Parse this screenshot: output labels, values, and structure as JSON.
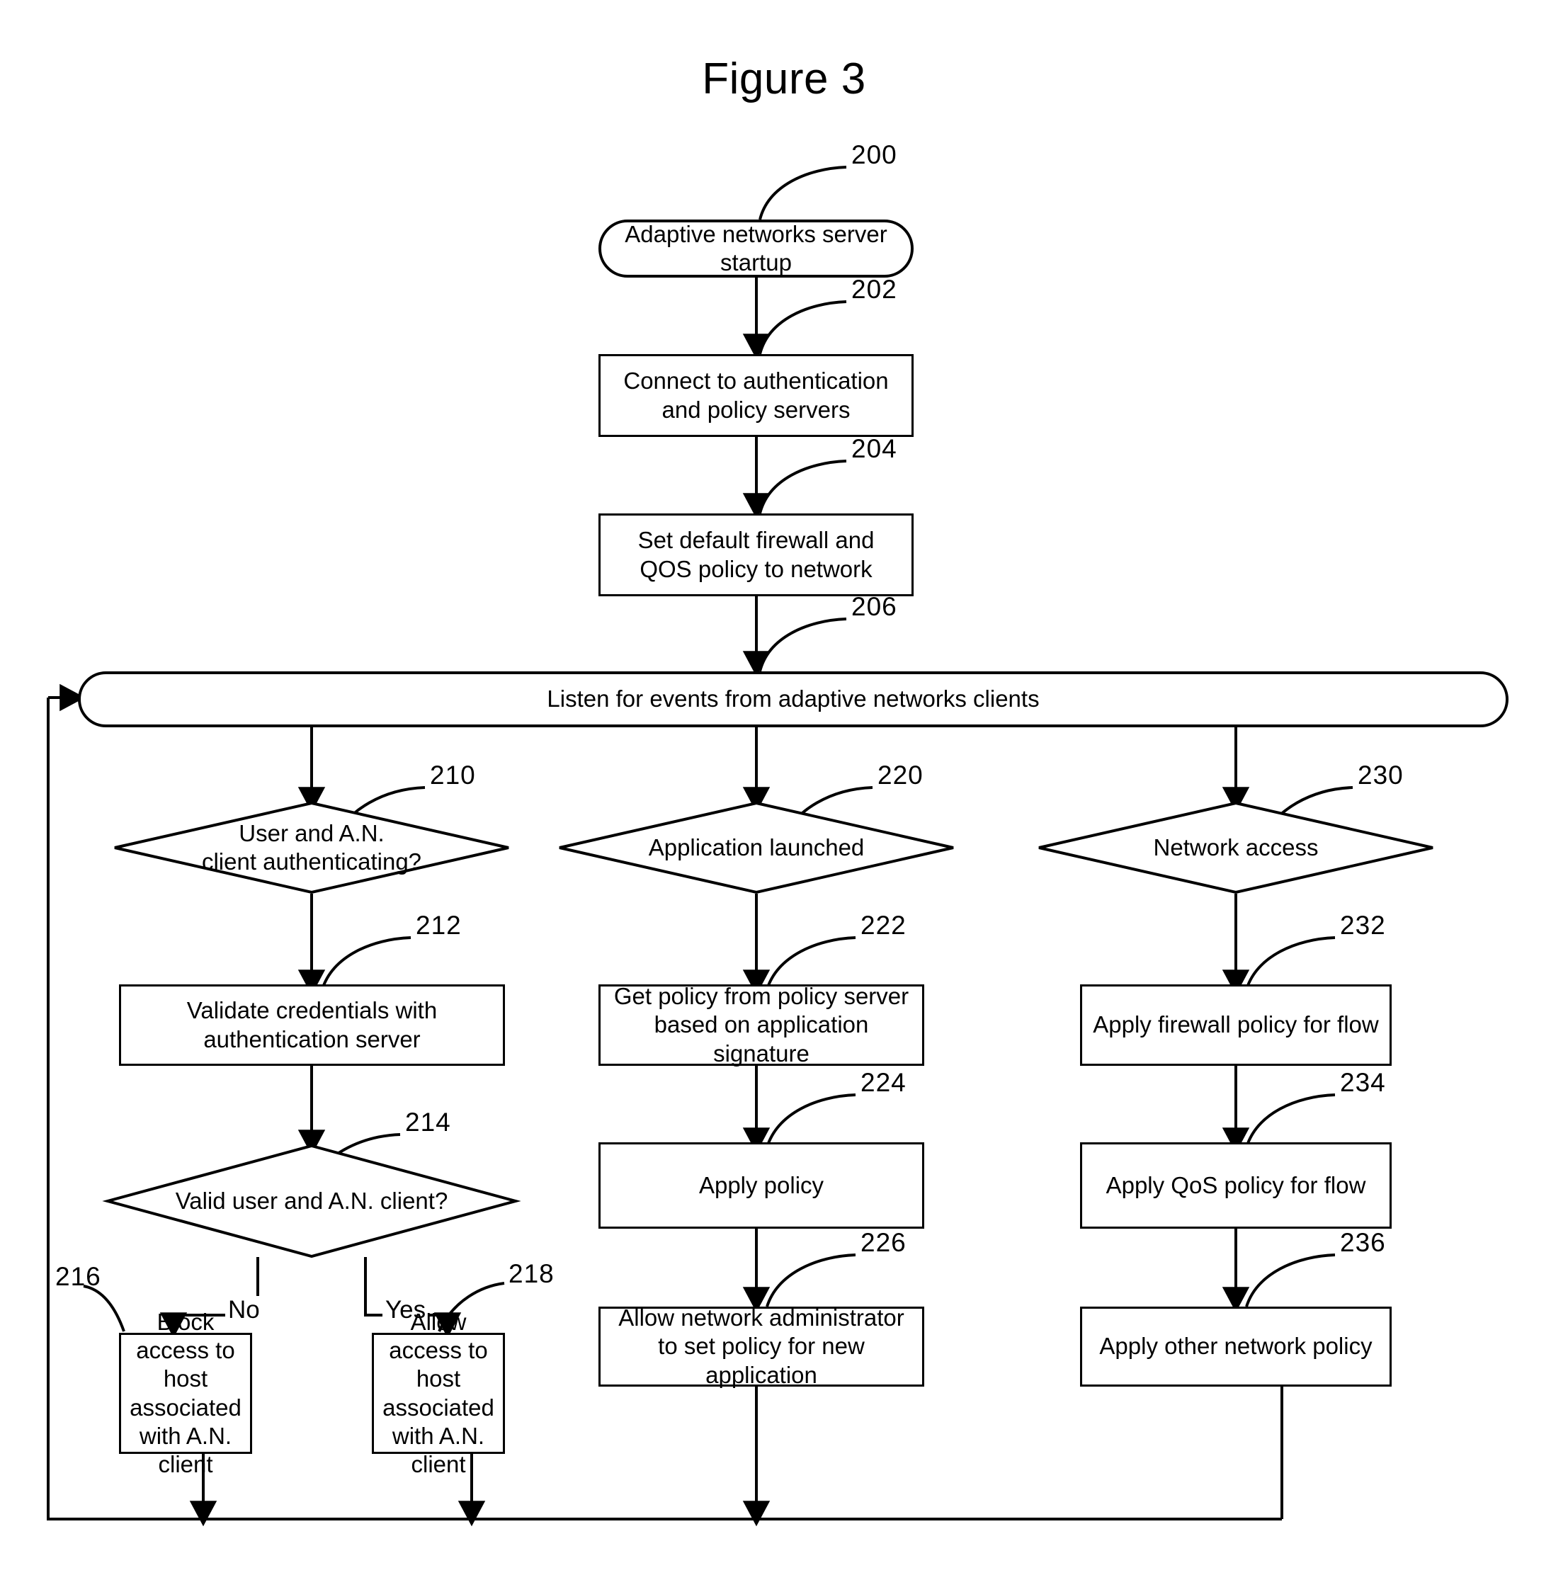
{
  "figure": {
    "title": "Figure 3"
  },
  "nodes": {
    "n200": {
      "ref": "200",
      "text": "Adaptive networks server startup"
    },
    "n202": {
      "ref": "202",
      "text": "Connect to authentication and policy servers"
    },
    "n204": {
      "ref": "204",
      "text": "Set default firewall and QOS policy to network"
    },
    "n206": {
      "ref": "206",
      "text": "Listen for events from adaptive networks clients"
    },
    "n210": {
      "ref": "210",
      "line1": "User and A.N.",
      "line2": "client authenticating?"
    },
    "n212": {
      "ref": "212",
      "text": "Validate credentials with authentication server"
    },
    "n214": {
      "ref": "214",
      "text": "Valid user and A.N. client?"
    },
    "n216": {
      "ref": "216",
      "text": "Block access to host associated with A.N. client"
    },
    "n218": {
      "ref": "218",
      "text": "Allow access to host associated with A.N. client"
    },
    "n220": {
      "ref": "220",
      "text": "Application launched"
    },
    "n222": {
      "ref": "222",
      "text": "Get policy from policy server based on application signature"
    },
    "n224": {
      "ref": "224",
      "text": "Apply policy"
    },
    "n226": {
      "ref": "226",
      "text": "Allow network administrator to set policy for new application"
    },
    "n230": {
      "ref": "230",
      "text": "Network access"
    },
    "n232": {
      "ref": "232",
      "text": "Apply firewall policy for flow"
    },
    "n234": {
      "ref": "234",
      "text": "Apply QoS policy for flow"
    },
    "n236": {
      "ref": "236",
      "text": "Apply other network policy"
    }
  },
  "branches": {
    "no": "No",
    "yes": "Yes"
  }
}
